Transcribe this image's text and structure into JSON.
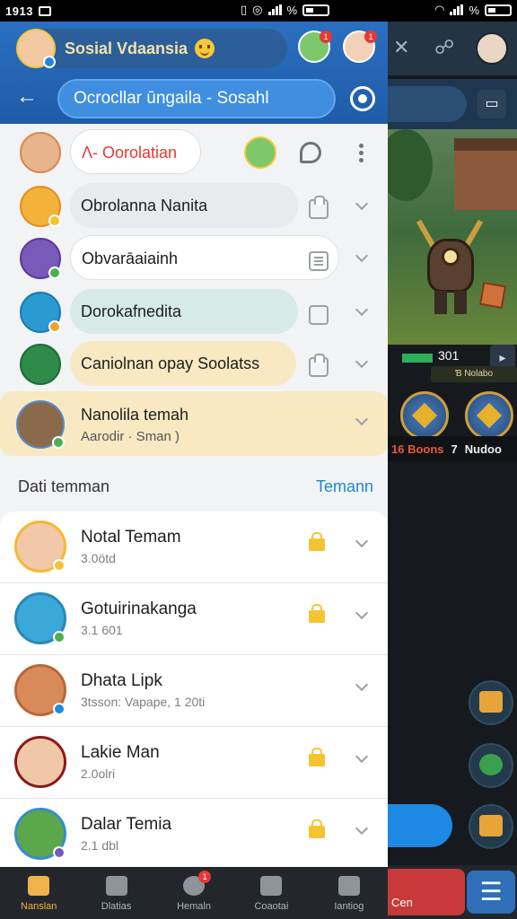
{
  "status_bar": {
    "time": "1913",
    "wifi_left": "%",
    "wifi_right": "%"
  },
  "header": {
    "app_title": "Sosial Vdaansia",
    "search_text": "Ocrocllar ūngaila - Sosahl"
  },
  "chats": [
    {
      "label": "Λ- Oorolatian",
      "color": "#e53935"
    },
    {
      "label": "Obrolanna Nanita"
    },
    {
      "label": "Obvarāaiainh"
    },
    {
      "label": "Dorokafnedita"
    },
    {
      "label": "Caniolnan opay Soolatss"
    }
  ],
  "highlight": {
    "title": "Nanolila temah",
    "subtitle": "Aarodir · Sman )"
  },
  "friends_section": {
    "label": "Dati temman",
    "action": "Temann"
  },
  "friends": [
    {
      "name": "Notal Temam",
      "sub": "3.0ötd"
    },
    {
      "name": "Gotuirinakanga",
      "sub": "3.1 601"
    },
    {
      "name": "Dhata Lipk",
      "sub": "3tsson: Vapape, 1 20ti"
    },
    {
      "name": "Lakie Man",
      "sub": "2.0olri"
    },
    {
      "name": "Dalar Temia",
      "sub": "2.1 dbl"
    }
  ],
  "bottom_nav": [
    {
      "label": "Nanslan",
      "active": true
    },
    {
      "label": "Dlatias"
    },
    {
      "label": "Hemaln",
      "badge": "1"
    },
    {
      "label": "Coaotai"
    },
    {
      "label": "Iantiog"
    }
  ],
  "game": {
    "hp_text": "301",
    "label": "Ɓ Nolabo",
    "stats_red": "16 Boons",
    "stats_num": "7",
    "stats_white": "Nudoo",
    "bottom_label": "Cen"
  }
}
